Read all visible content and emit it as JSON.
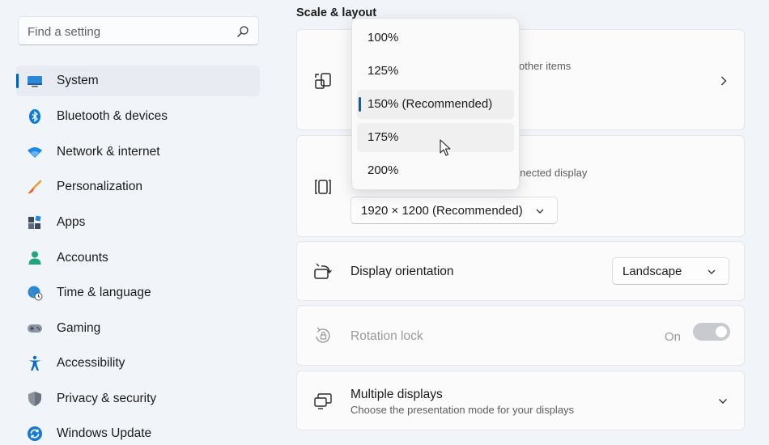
{
  "search": {
    "placeholder": "Find a setting",
    "icon": "search-icon"
  },
  "sidebar": {
    "accent": "#005fb8",
    "items": [
      {
        "label": "System",
        "icon": "monitor-icon",
        "active": true
      },
      {
        "label": "Bluetooth & devices",
        "icon": "bluetooth-icon"
      },
      {
        "label": "Network & internet",
        "icon": "wifi-icon"
      },
      {
        "label": "Personalization",
        "icon": "brush-icon"
      },
      {
        "label": "Apps",
        "icon": "apps-icon"
      },
      {
        "label": "Accounts",
        "icon": "person-icon"
      },
      {
        "label": "Time & language",
        "icon": "globe-clock-icon"
      },
      {
        "label": "Gaming",
        "icon": "gamepad-icon"
      },
      {
        "label": "Accessibility",
        "icon": "accessibility-icon"
      },
      {
        "label": "Privacy & security",
        "icon": "shield-icon"
      },
      {
        "label": "Windows Update",
        "icon": "update-icon"
      }
    ]
  },
  "main": {
    "section_title": "Scale & layout",
    "scale_card": {
      "subtitle_fragment": "other items",
      "icon": "scale-icon"
    },
    "resolution_card": {
      "subtitle_fragment": "nnected display",
      "value": "1920 × 1200 (Recommended)",
      "icon": "resolution-icon"
    },
    "orientation_card": {
      "title": "Display orientation",
      "value": "Landscape",
      "icon": "orientation-icon"
    },
    "rotation_card": {
      "title": "Rotation lock",
      "state": "On",
      "disabled": true,
      "icon": "rotation-lock-icon"
    },
    "multiple_card": {
      "title": "Multiple displays",
      "subtitle": "Choose the presentation mode for your displays",
      "icon": "multiple-displays-icon"
    }
  },
  "scale_dropdown": {
    "options": [
      "100%",
      "125%",
      "150% (Recommended)",
      "175%",
      "200%"
    ],
    "selected": "150% (Recommended)",
    "hovered": "175%"
  }
}
